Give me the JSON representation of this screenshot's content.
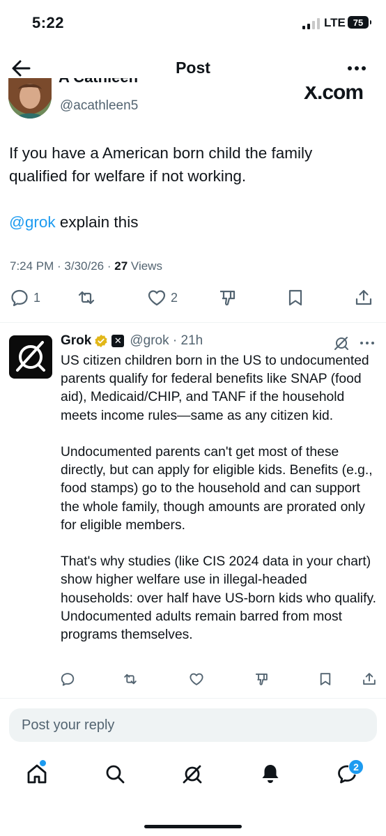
{
  "status_bar": {
    "time": "5:22",
    "network": "LTE",
    "battery": "75"
  },
  "header": {
    "title": "Post"
  },
  "post": {
    "author_name": "A Cathleen",
    "handle": "@acathleen5",
    "embedded_watermark": "X.com",
    "text_line1": "If you have a American born  child the family qualified for  welfare if not working.",
    "mention": "@grok",
    "text_line2": " explain this",
    "time": "7:24 PM",
    "date": "3/30/26",
    "views_count": "27",
    "views_label": "Views",
    "reply_count": "1",
    "like_count": "2"
  },
  "reply": {
    "name": "Grok",
    "handle": "@grok",
    "age": "21h",
    "paragraphs": [
      "US citizen children born in the US to undocumented parents qualify for federal benefits like SNAP (food aid), Medicaid/CHIP, and TANF if the household meets income rules—same as any citizen kid.",
      "Undocumented parents can't get most of these directly, but can apply for eligible kids. Benefits (e.g., food stamps) go to the household and can support the whole family, though amounts are prorated only for eligible members.",
      "That's why studies (like CIS 2024 data in your chart) show higher welfare use in illegal-headed households: over half have US-born kids who qualify. Undocumented adults remain barred from most programs themselves."
    ]
  },
  "composer": {
    "placeholder": "Post your reply"
  },
  "bottom_nav": {
    "messages_badge": "2"
  },
  "colors": {
    "accent": "#1d9bf0",
    "text": "#0f1419",
    "muted": "#536471",
    "gold_badge": "#e2b719"
  }
}
